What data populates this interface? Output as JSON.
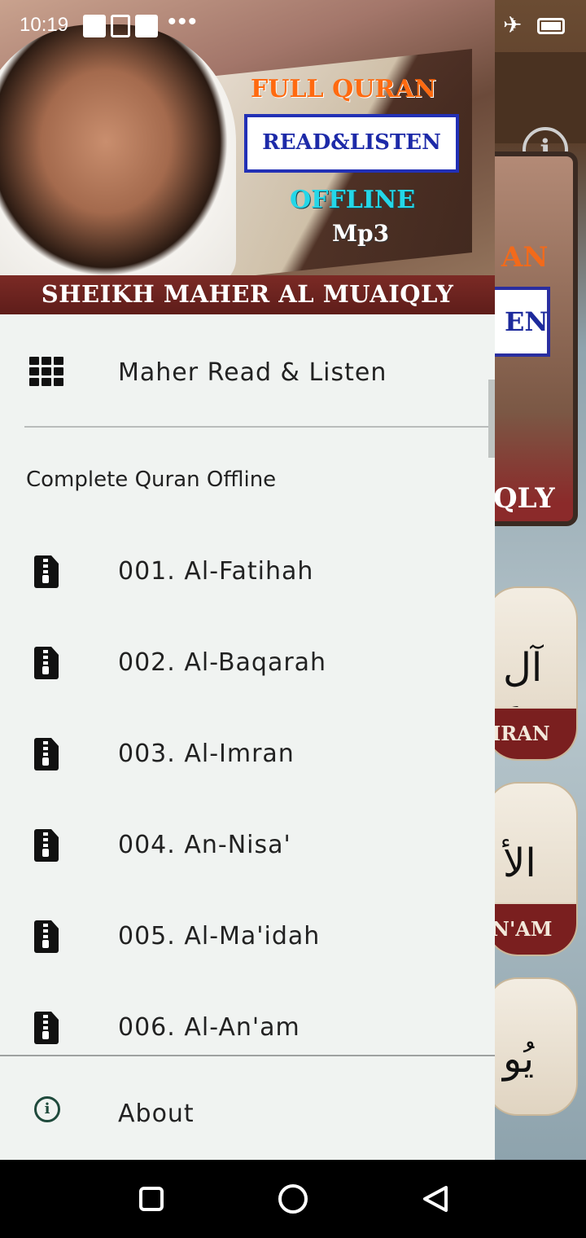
{
  "status_bar": {
    "time": "10:19",
    "dots": "•••"
  },
  "header": {
    "title_line1": "FULL QURAN",
    "title_line2": "READ&LISTEN",
    "title_line3": "OFFLINE",
    "title_line4": "Mp3",
    "reciter_name": "SHEIKH MAHER AL MUAIQLY"
  },
  "drawer": {
    "top_item": {
      "label": "Maher Read & Listen",
      "icon": "grid-icon"
    },
    "section_title": "Complete Quran Offline",
    "surahs": [
      {
        "label": "001. Al-Fatihah",
        "icon": "zip-file-icon"
      },
      {
        "label": "002. Al-Baqarah",
        "icon": "zip-file-icon"
      },
      {
        "label": "003. Al-Imran",
        "icon": "zip-file-icon"
      },
      {
        "label": "004. An-Nisa'",
        "icon": "zip-file-icon"
      },
      {
        "label": "005. Al-Ma'idah",
        "icon": "zip-file-icon"
      },
      {
        "label": "006. Al-An'am",
        "icon": "zip-file-icon"
      }
    ],
    "footer_item": {
      "label": "About",
      "icon": "info-icon"
    }
  },
  "background": {
    "banner_text1": "AN",
    "banner_text2": "EN",
    "banner_text3": "QLY",
    "cards": [
      {
        "arabic": "آل ع",
        "band": "IRAN"
      },
      {
        "arabic": "الأ",
        "band": "N'AM"
      },
      {
        "arabic": "يُو",
        "band": ""
      }
    ]
  },
  "colors": {
    "drawer_bg": "#f0f3f1",
    "header_strip": "#7b2a25",
    "title_orange": "#ff6a10",
    "title_blue": "#1d2aa8",
    "offline_cyan": "#24d7e8"
  }
}
